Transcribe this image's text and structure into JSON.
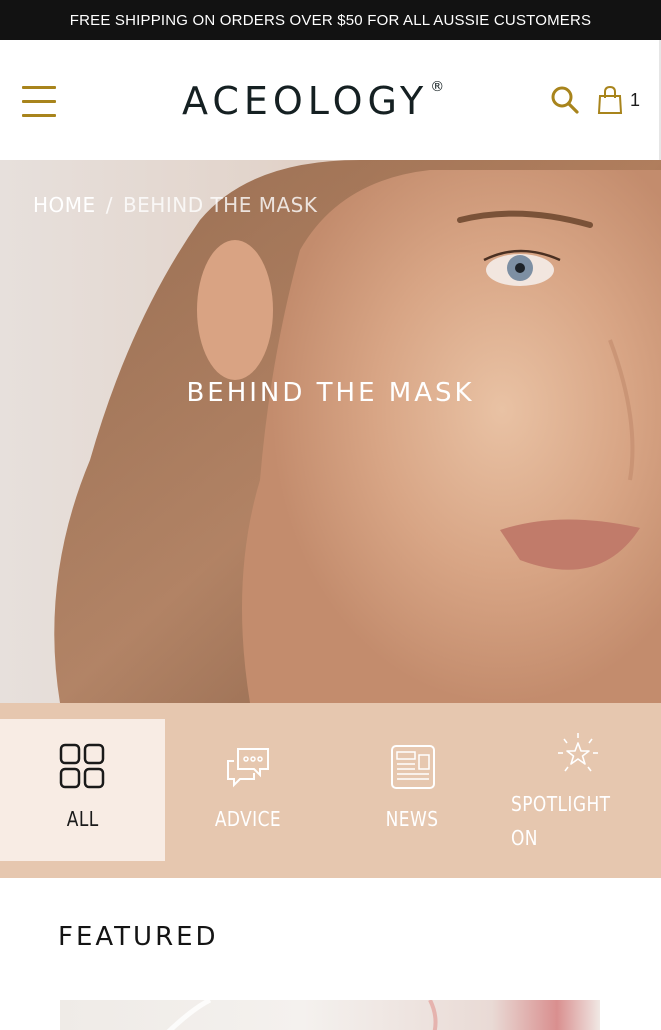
{
  "announcement": {
    "text": "FREE SHIPPING ON ORDERS OVER $50 FOR ALL AUSSIE CUSTOMERS"
  },
  "header": {
    "menu_icon": "hamburger-icon",
    "logo": {
      "text": "ACEOLOGY",
      "mark": "®"
    },
    "search_icon": "search-icon",
    "cart_icon": "shopping-bag-icon",
    "cart_count": "1"
  },
  "colors": {
    "accent_gold": "#a8841c",
    "announcement_bg": "#121212",
    "category_bar_bg": "#e6c7af",
    "category_active_bg": "#f8ece4",
    "logo_text": "#152022"
  },
  "hero": {
    "breadcrumb": {
      "home": "HOME",
      "separator": "/",
      "current": "BEHIND THE MASK"
    },
    "title": "BEHIND THE MASK"
  },
  "categories": {
    "items": [
      {
        "label": "ALL",
        "icon": "grid-icon",
        "active": true
      },
      {
        "label": "ADVICE",
        "icon": "chat-bubbles-icon",
        "active": false
      },
      {
        "label": "NEWS",
        "icon": "newspaper-icon",
        "active": false
      },
      {
        "label": "SPOTLIGHT",
        "label_line2": "ON",
        "icon": "star-sparkle-icon",
        "active": false
      }
    ]
  },
  "featured": {
    "heading": "FEATURED"
  }
}
